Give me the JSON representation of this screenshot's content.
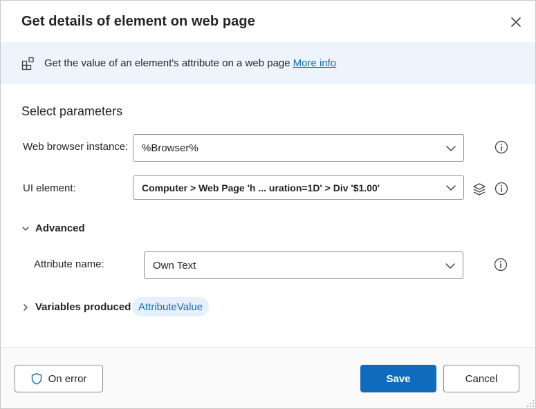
{
  "dialog": {
    "title": "Get details of element on web page",
    "close_icon": "close-icon"
  },
  "banner": {
    "icon": "action-blocks-icon",
    "text": "Get the value of an element's attribute on a web page",
    "link": "More info"
  },
  "parameters": {
    "section_title": "Select parameters",
    "browser_instance": {
      "label": "Web browser instance:",
      "value": "%Browser%"
    },
    "ui_element": {
      "label": "UI element:",
      "value": "Computer > Web Page 'h ... uration=1D' > Div '$1.00'"
    },
    "advanced": {
      "label": "Advanced",
      "expanded": true
    },
    "attribute_name": {
      "label": "Attribute name:",
      "value": "Own Text"
    },
    "variables_produced": {
      "label": "Variables produced",
      "expanded": false,
      "variable": "AttributeValue"
    }
  },
  "footer": {
    "on_error": "On error",
    "save": "Save",
    "cancel": "Cancel"
  },
  "colors": {
    "accent": "#0f6cbd",
    "banner_bg": "#eef4fb",
    "pill_bg": "#e6f0fb"
  }
}
